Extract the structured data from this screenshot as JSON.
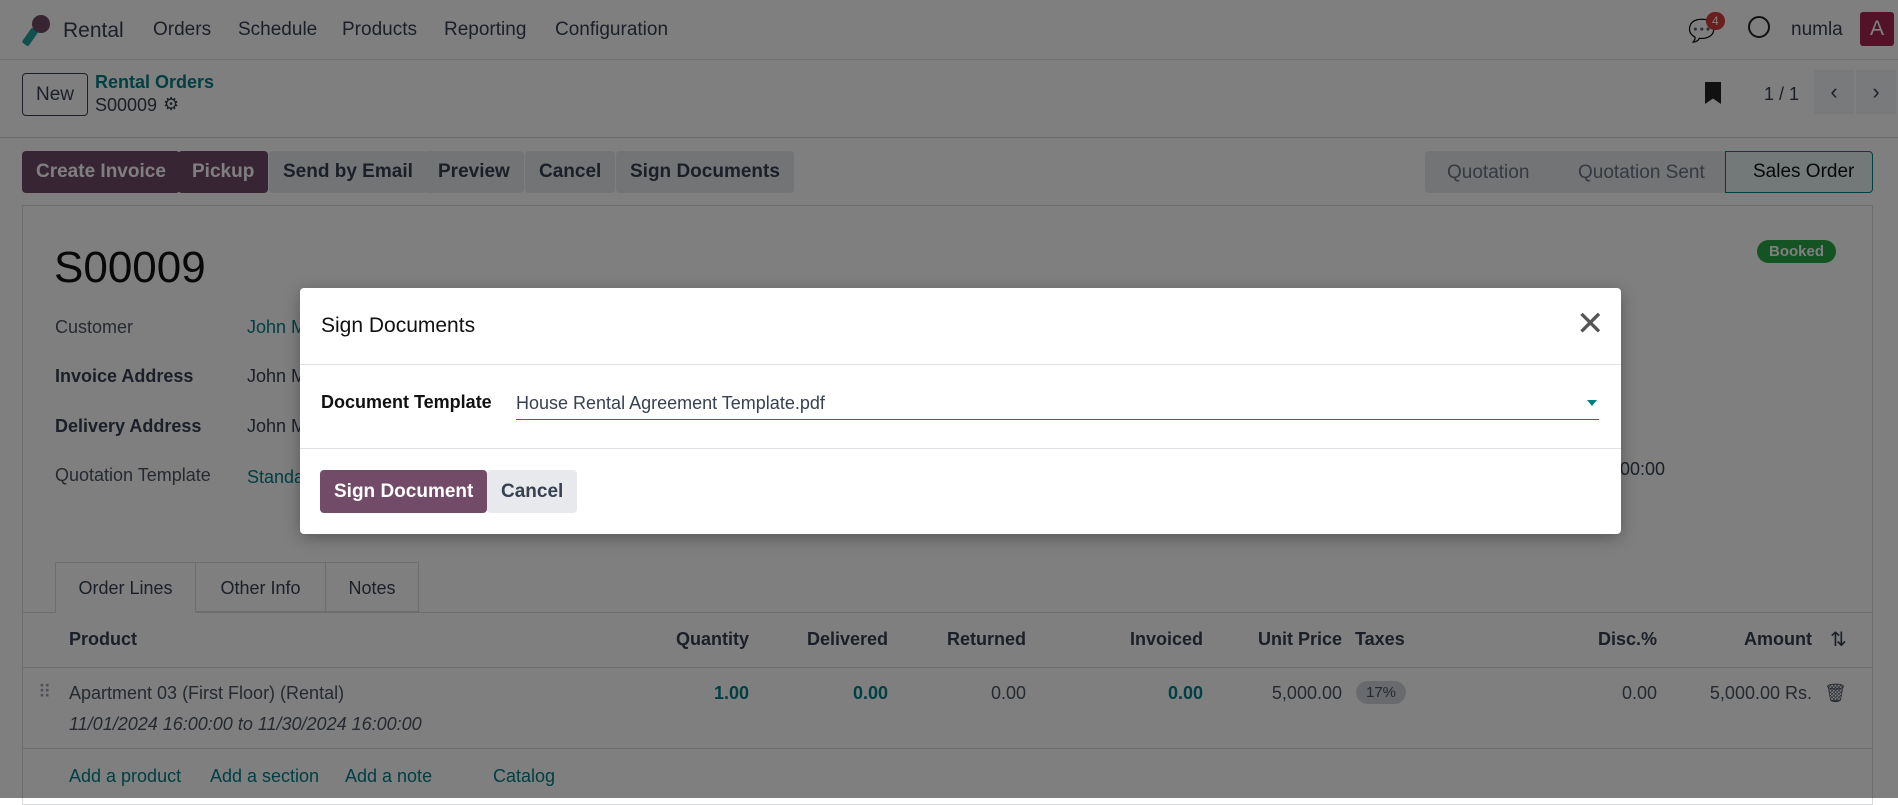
{
  "navbar": {
    "app": "Rental",
    "menu": [
      "Orders",
      "Schedule",
      "Products",
      "Reporting",
      "Configuration"
    ],
    "messages_count": "4",
    "user": "numla",
    "avatar_letter": "A",
    "brand_color": "#714b67"
  },
  "control_panel": {
    "new_label": "New",
    "breadcrumb_parent": "Rental Orders",
    "breadcrumb_current": "S00009",
    "pager": "1 / 1"
  },
  "actions": [
    "Create Invoice",
    "Pickup",
    "Send by Email",
    "Preview",
    "Cancel",
    "Sign Documents"
  ],
  "statusbar": [
    "Quotation",
    "Quotation Sent",
    "Sales Order"
  ],
  "form": {
    "title": "S00009",
    "badge": "Booked",
    "fields": [
      {
        "label": "Customer",
        "value": "John M"
      },
      {
        "label": "Invoice Address",
        "value": "John M"
      },
      {
        "label": "Delivery Address",
        "value": "John M"
      },
      {
        "label": "Quotation Template",
        "value": "Standa"
      }
    ],
    "right_partial": ":00:00",
    "tabs": [
      "Order Lines",
      "Other Info",
      "Notes"
    ],
    "columns": [
      "Product",
      "Quantity",
      "Delivered",
      "Returned",
      "Invoiced",
      "Unit Price",
      "Taxes",
      "Disc.%",
      "Amount"
    ],
    "line": {
      "product": "Apartment 03 (First Floor) (Rental)",
      "period": "11/01/2024 16:00:00 to 11/30/2024 16:00:00",
      "quantity": "1.00",
      "delivered": "0.00",
      "returned": "0.00",
      "invoiced": "0.00",
      "unit_price": "5,000.00",
      "tax": "17%",
      "discount": "0.00",
      "amount": "5,000.00 Rs."
    },
    "add_links": [
      "Add a product",
      "Add a section",
      "Add a note",
      "Catalog"
    ]
  },
  "dialog": {
    "title": "Sign Documents",
    "field_label": "Document Template",
    "field_value": "House Rental Agreement Template.pdf",
    "confirm": "Sign Document",
    "cancel": "Cancel"
  }
}
